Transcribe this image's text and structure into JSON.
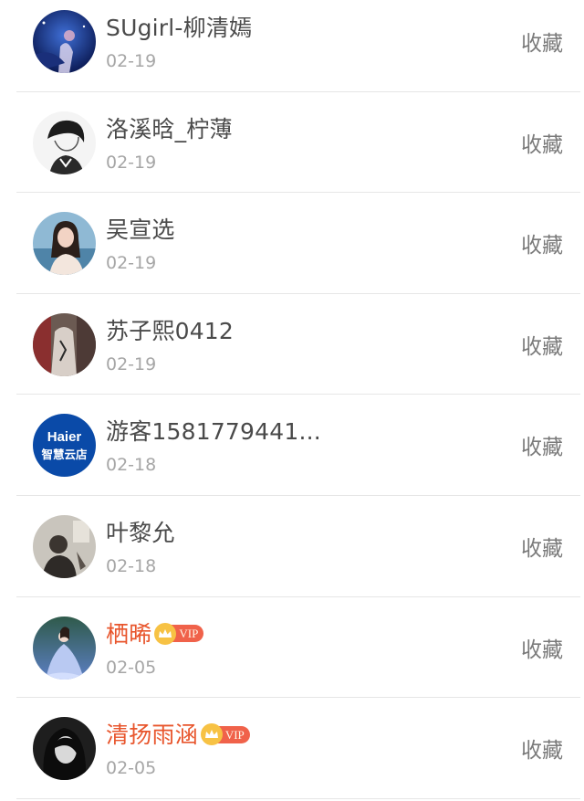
{
  "collect_label": "收藏",
  "vip": {
    "label": "VIP",
    "crown_color": "#f7c244",
    "badge_color": "#f0624a",
    "name_color": "#e8552c"
  },
  "users": [
    {
      "name": "SUgirl-柳清嫣",
      "date": "02-19",
      "vip": false,
      "avatar": "space-avatar"
    },
    {
      "name": "洛溪晗_柠薄",
      "date": "02-19",
      "vip": false,
      "avatar": "sketch-avatar"
    },
    {
      "name": "吴宣选",
      "date": "02-19",
      "vip": false,
      "avatar": "girl-sea-avatar"
    },
    {
      "name": "苏子熙0412",
      "date": "02-19",
      "vip": false,
      "avatar": "boy-avatar"
    },
    {
      "name": "游客1581779441...",
      "date": "02-18",
      "vip": false,
      "avatar": "haier-logo-avatar",
      "logo_text": [
        "Haier",
        "智慧云店"
      ]
    },
    {
      "name": "叶黎允",
      "date": "02-18",
      "vip": false,
      "avatar": "dark-photo-avatar"
    },
    {
      "name": "栖晞",
      "date": "02-05",
      "vip": true,
      "avatar": "blue-dress-avatar"
    },
    {
      "name": "清扬雨涵",
      "date": "02-05",
      "vip": true,
      "avatar": "bw-portrait-avatar"
    }
  ]
}
